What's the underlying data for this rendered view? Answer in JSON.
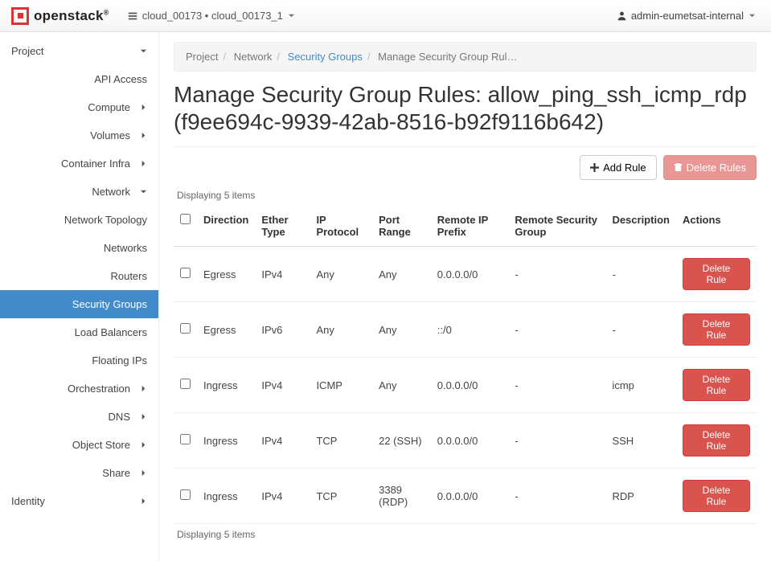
{
  "topbar": {
    "brand": "openstack",
    "project_selector": "cloud_00173 • cloud_00173_1",
    "user": "admin-eumetsat-internal"
  },
  "sidebar": {
    "project_label": "Project",
    "api_access": "API Access",
    "compute": "Compute",
    "volumes": "Volumes",
    "container_infra": "Container Infra",
    "network": "Network",
    "network_children": {
      "topology": "Network Topology",
      "networks": "Networks",
      "routers": "Routers",
      "security_groups": "Security Groups",
      "load_balancers": "Load Balancers",
      "floating_ips": "Floating IPs"
    },
    "orchestration": "Orchestration",
    "dns": "DNS",
    "object_store": "Object Store",
    "share": "Share",
    "identity": "Identity"
  },
  "breadcrumbs": {
    "b1": "Project",
    "b2": "Network",
    "b3": "Security Groups",
    "b4": "Manage Security Group Rul…"
  },
  "page": {
    "title": "Manage Security Group Rules: allow_ping_ssh_icmp_rdp (f9ee694c-9939-42ab-8516-b92f9116b642)",
    "add_rule": "Add Rule",
    "delete_rules": "Delete Rules",
    "count_top": "Displaying 5 items",
    "count_bottom": "Displaying 5 items"
  },
  "table": {
    "headers": {
      "direction": "Direction",
      "ether": "Ether Type",
      "proto": "IP Protocol",
      "port": "Port Range",
      "prefix": "Remote IP Prefix",
      "remote_sg": "Remote Security Group",
      "desc": "Description",
      "actions": "Actions"
    },
    "rows": [
      {
        "direction": "Egress",
        "ether": "IPv4",
        "proto": "Any",
        "port": "Any",
        "prefix": "0.0.0.0/0",
        "rsg": "-",
        "desc": "-",
        "action": "Delete Rule"
      },
      {
        "direction": "Egress",
        "ether": "IPv6",
        "proto": "Any",
        "port": "Any",
        "prefix": "::/0",
        "rsg": "-",
        "desc": "-",
        "action": "Delete Rule"
      },
      {
        "direction": "Ingress",
        "ether": "IPv4",
        "proto": "ICMP",
        "port": "Any",
        "prefix": "0.0.0.0/0",
        "rsg": "-",
        "desc": "icmp",
        "action": "Delete Rule"
      },
      {
        "direction": "Ingress",
        "ether": "IPv4",
        "proto": "TCP",
        "port": "22 (SSH)",
        "prefix": "0.0.0.0/0",
        "rsg": "-",
        "desc": "SSH",
        "action": "Delete Rule"
      },
      {
        "direction": "Ingress",
        "ether": "IPv4",
        "proto": "TCP",
        "port": "3389 (RDP)",
        "prefix": "0.0.0.0/0",
        "rsg": "-",
        "desc": "RDP",
        "action": "Delete Rule"
      }
    ]
  }
}
